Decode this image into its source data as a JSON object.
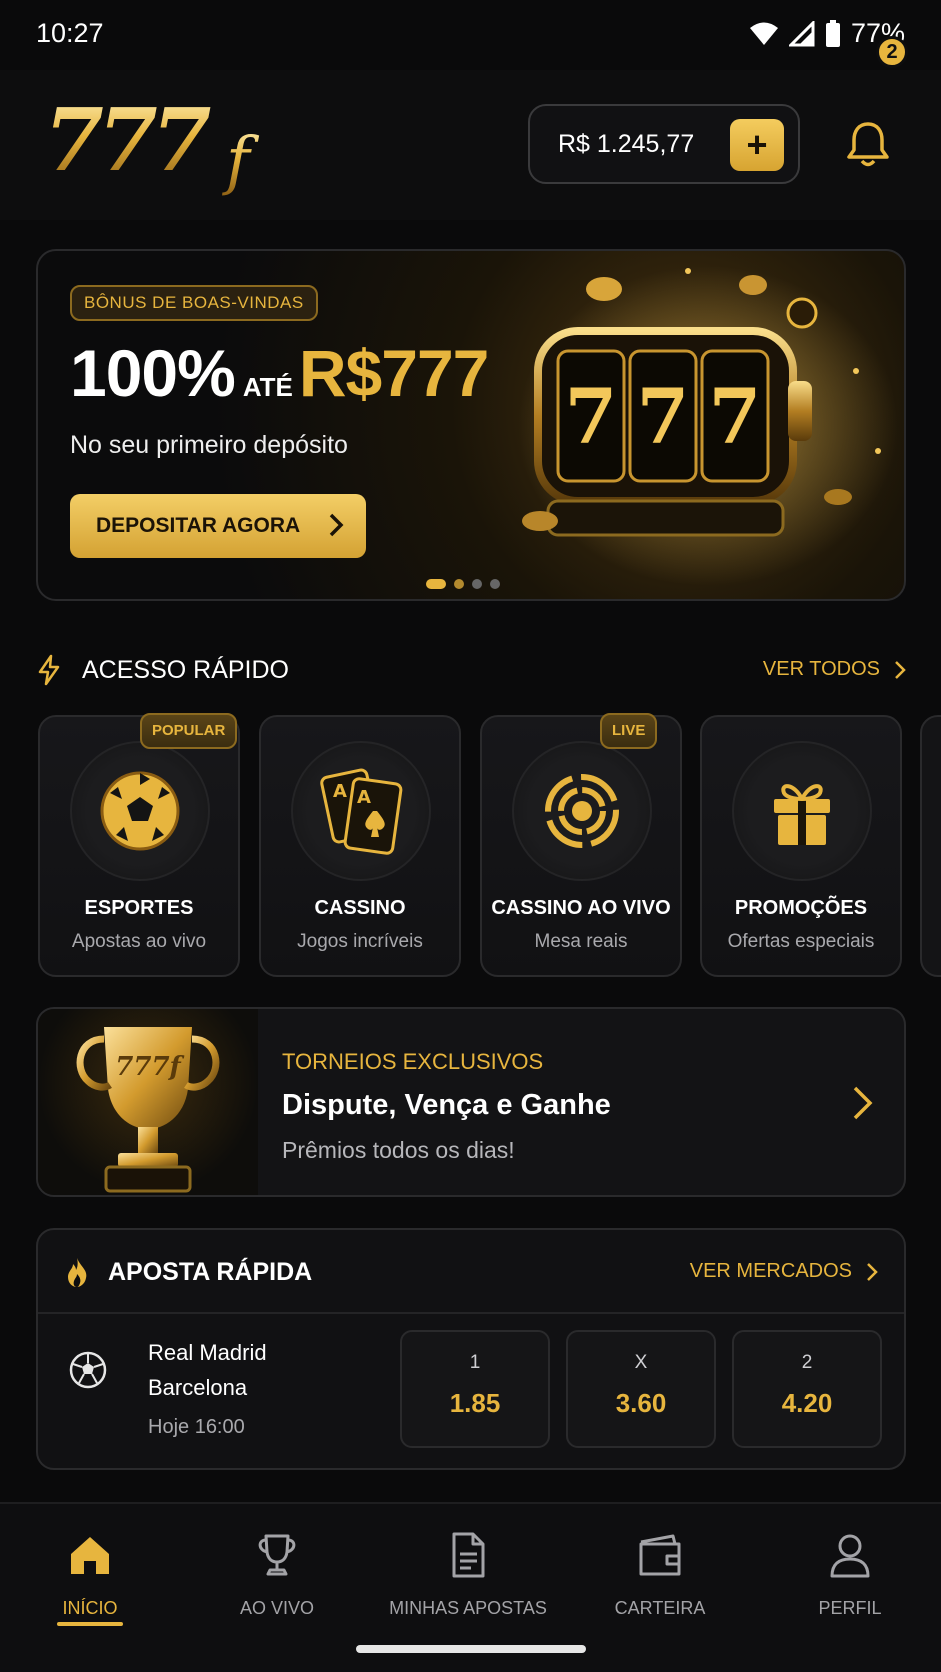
{
  "status": {
    "time": "10:27",
    "battery": "77%"
  },
  "header": {
    "logo_text": "777f",
    "balance": "R$ 1.245,77",
    "add_label": "+",
    "notifications": "2"
  },
  "hero": {
    "tag": "BÔNUS DE BOAS-VINDAS",
    "percent": "100%",
    "ate": "ATÉ",
    "amount": "R$777",
    "subtitle": "No seu primeiro depósito",
    "cta": "DEPOSITAR AGORA",
    "slot_digits": [
      "7",
      "7",
      "7"
    ]
  },
  "quick_access": {
    "title": "ACESSO RÁPIDO",
    "link": "VER TODOS",
    "items": [
      {
        "label": "ESPORTES",
        "desc": "Apostas ao vivo",
        "badge": "POPULAR",
        "icon": "soccer-ball-icon"
      },
      {
        "label": "CASSINO",
        "desc": "Jogos incríveis",
        "badge": "",
        "icon": "playing-cards-icon"
      },
      {
        "label": "CASSINO AO VIVO",
        "desc": "Mesa reais",
        "badge": "LIVE",
        "icon": "live-broadcast-icon"
      },
      {
        "label": "PROMOÇÕES",
        "desc": "Ofertas especiais",
        "badge": "",
        "icon": "gift-icon"
      }
    ]
  },
  "tournament": {
    "kicker": "TORNEIOS EXCLUSIVOS",
    "title": "Dispute, Vença e Ganhe",
    "subtitle": "Prêmios todos os dias!",
    "trophy_text": "777f"
  },
  "quick_bet": {
    "title": "APOSTA RÁPIDA",
    "link": "VER MERCADOS",
    "match": {
      "home": "Real Madrid",
      "away": "Barcelona",
      "when": "Hoje 16:00"
    },
    "odds": [
      {
        "key": "1",
        "value": "1.85"
      },
      {
        "key": "X",
        "value": "3.60"
      },
      {
        "key": "2",
        "value": "4.20"
      }
    ]
  },
  "nav": [
    {
      "label": "INÍCIO",
      "icon": "home-icon",
      "active": true
    },
    {
      "label": "AO VIVO",
      "icon": "trophy-icon",
      "active": false
    },
    {
      "label": "MINHAS APOSTAS",
      "icon": "document-icon",
      "active": false
    },
    {
      "label": "CARTEIRA",
      "icon": "wallet-icon",
      "active": false
    },
    {
      "label": "PERFIL",
      "icon": "user-icon",
      "active": false
    }
  ],
  "colors": {
    "accent": "#e7b53e",
    "background": "#0a0a0b",
    "card": "#131315"
  }
}
